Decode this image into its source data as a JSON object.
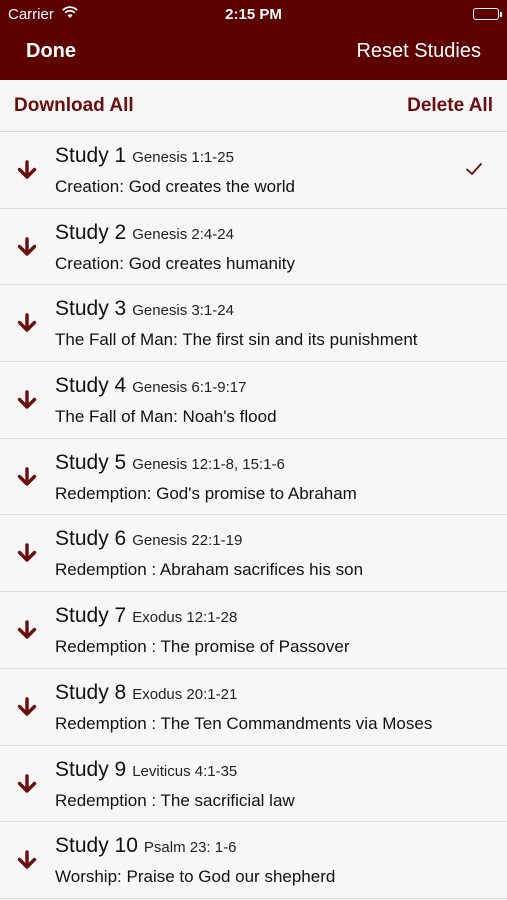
{
  "status_bar": {
    "carrier": "Carrier",
    "time": "2:15 PM"
  },
  "nav": {
    "done_label": "Done",
    "reset_label": "Reset Studies"
  },
  "toolbar": {
    "download_all_label": "Download All",
    "delete_all_label": "Delete All"
  },
  "colors": {
    "header_bg": "#5c0000",
    "accent": "#6b0d0d"
  },
  "icons": {
    "download": "down-arrow-icon",
    "checked": "checkmark-icon"
  },
  "studies": [
    {
      "title": "Study 1",
      "reference": "Genesis 1:1-25",
      "description": "Creation: God creates the world",
      "checked": true
    },
    {
      "title": "Study 2",
      "reference": "Genesis 2:4-24",
      "description": "Creation: God creates humanity",
      "checked": false
    },
    {
      "title": "Study 3",
      "reference": "Genesis 3:1-24",
      "description": "The Fall of Man: The first sin and its punishment",
      "checked": false
    },
    {
      "title": "Study 4",
      "reference": "Genesis 6:1-9:17",
      "description": "The Fall of Man: Noah's flood",
      "checked": false
    },
    {
      "title": "Study 5",
      "reference": "Genesis 12:1-8, 15:1-6",
      "description": "Redemption: God's promise to Abraham",
      "checked": false
    },
    {
      "title": "Study 6",
      "reference": "Genesis 22:1-19",
      "description": "Redemption : Abraham sacrifices his son",
      "checked": false
    },
    {
      "title": "Study 7",
      "reference": "Exodus 12:1-28",
      "description": "Redemption : The promise of Passover",
      "checked": false
    },
    {
      "title": "Study 8",
      "reference": "Exodus 20:1-21",
      "description": "Redemption : The Ten Commandments via Moses",
      "checked": false
    },
    {
      "title": "Study 9",
      "reference": "Leviticus 4:1-35",
      "description": "Redemption : The sacrificial law",
      "checked": false
    },
    {
      "title": "Study 10",
      "reference": "Psalm 23: 1-6",
      "description": "Worship: Praise to God our shepherd",
      "checked": false
    }
  ]
}
